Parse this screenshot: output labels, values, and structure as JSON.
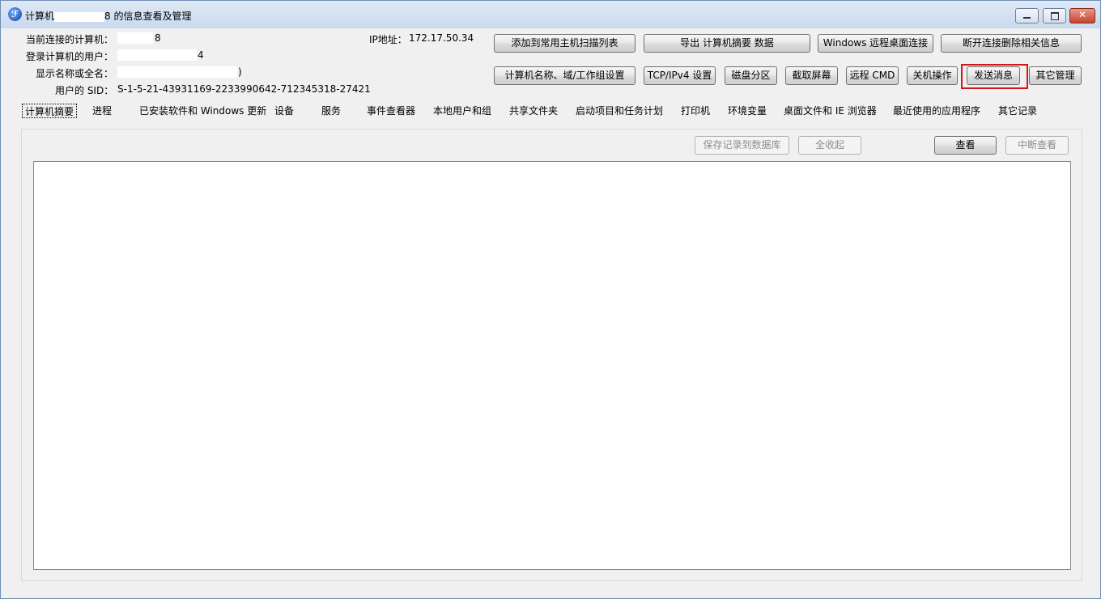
{
  "window": {
    "title_prefix": "计算机",
    "title_suffix": "8 的信息查看及管理",
    "app_icon_glyph": "ℱ"
  },
  "info": {
    "computer_label": "当前连接的计算机：",
    "computer_value": "8",
    "user_label": "登录计算机的用户：",
    "user_value": "4",
    "display_label": "显示名称或全名：",
    "display_value": ")",
    "sid_label": "用户的 SID：",
    "sid_value": "S-1-5-21-43931169-2233990642-712345318-27421",
    "ip_label": "IP地址：",
    "ip_value": "172.17.50.34"
  },
  "toolbar_row1": [
    {
      "label": "添加到常用主机扫描列表"
    },
    {
      "label": "导出 计算机摘要 数据"
    },
    {
      "label": "Windows 远程桌面连接"
    },
    {
      "label": "断开连接删除相关信息"
    }
  ],
  "toolbar_row2": [
    {
      "label": "计算机名称、域/工作组设置"
    },
    {
      "label": "TCP/IPv4 设置"
    },
    {
      "label": "磁盘分区"
    },
    {
      "label": "截取屏幕"
    },
    {
      "label": "远程 CMD"
    },
    {
      "label": "关机操作"
    },
    {
      "label": "发送消息"
    },
    {
      "label": "其它管理"
    }
  ],
  "tabs": [
    {
      "label": "计算机摘要"
    },
    {
      "label": "进程"
    },
    {
      "label": "已安装软件和 Windows 更新"
    },
    {
      "label": "设备"
    },
    {
      "label": "服务"
    },
    {
      "label": "事件查看器"
    },
    {
      "label": "本地用户和组"
    },
    {
      "label": "共享文件夹"
    },
    {
      "label": "启动项目和任务计划"
    },
    {
      "label": "打印机"
    },
    {
      "label": "环境变量"
    },
    {
      "label": "桌面文件和 IE 浏览器"
    },
    {
      "label": "最近使用的应用程序"
    },
    {
      "label": "其它记录"
    }
  ],
  "panel": {
    "save_label": "保存记录到数据库",
    "collapse_label": "全收起",
    "view_label": "查看",
    "stop_label": "中断查看"
  },
  "colors": {
    "highlight": "#d4161a",
    "titlebar": "#c9daee"
  }
}
